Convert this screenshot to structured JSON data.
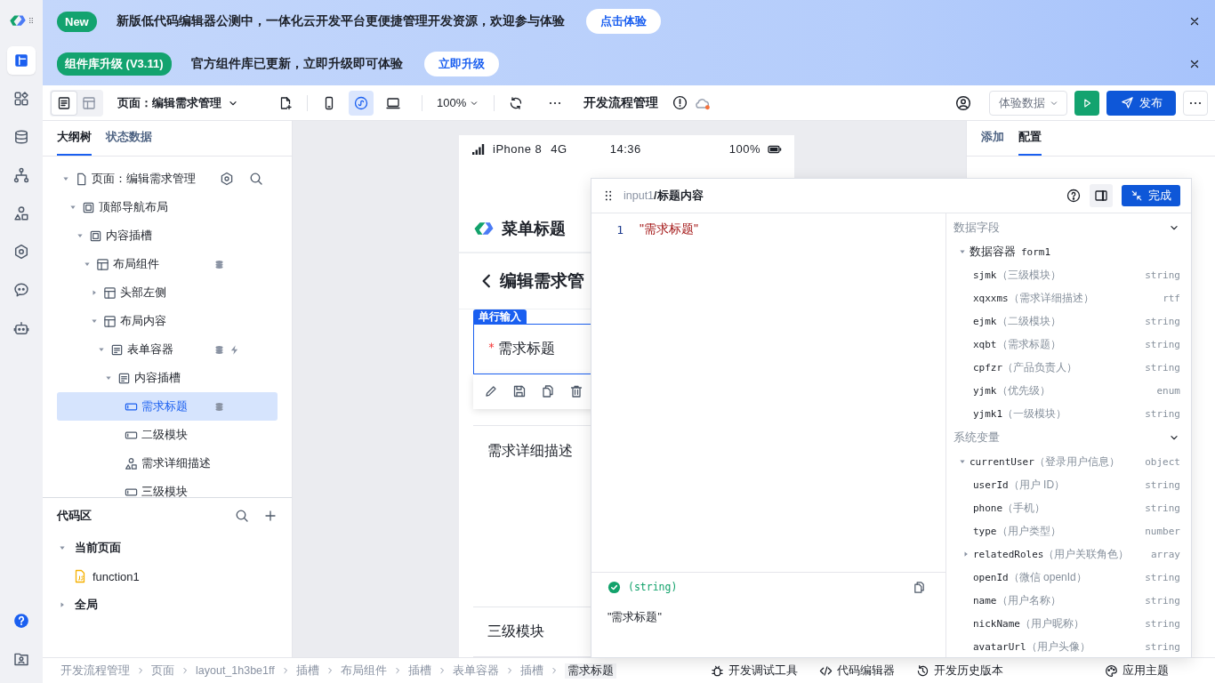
{
  "rail": {
    "top": [
      {
        "kind": "outline",
        "selected": true
      },
      {
        "kind": "components",
        "selected": false
      },
      {
        "kind": "database",
        "selected": false
      },
      {
        "kind": "flow",
        "selected": false
      },
      {
        "kind": "shapes",
        "selected": false
      },
      {
        "kind": "settings",
        "selected": false
      },
      {
        "kind": "chat",
        "selected": false
      },
      {
        "kind": "robot",
        "selected": false
      }
    ],
    "bottom": [
      {
        "kind": "help"
      },
      {
        "kind": "contact"
      }
    ]
  },
  "banners": [
    {
      "badge": "New",
      "text": "新版低代码编辑器公测中，一体化云开发平台更便捷管理开发资源，欢迎参与体验",
      "button": "点击体验"
    },
    {
      "badge": "组件库升级 (V3.11)",
      "text": "官方组件库已更新，立即升级即可体验",
      "button": "立即升级"
    }
  ],
  "toolbar": {
    "view_modes": [
      {
        "kind": "list",
        "selected": true
      },
      {
        "kind": "layout",
        "selected": false
      }
    ],
    "page_select": "页面：编辑需求管理",
    "devices": [
      {
        "kind": "phone",
        "selected": false
      },
      {
        "kind": "miniapp",
        "selected": true
      },
      {
        "kind": "desktop",
        "selected": false
      }
    ],
    "zoom": "100%",
    "title": "开发流程管理",
    "data_select": "体验数据",
    "publish": "发布"
  },
  "left_panel": {
    "tabs": [
      {
        "label": "大纲树",
        "selected": true
      },
      {
        "label": "状态数据",
        "selected": false
      }
    ],
    "outline": [
      {
        "label": "页面：编辑需求管理",
        "kind": "page",
        "expanded": true,
        "selected": false,
        "children": [
          {
            "label": "顶部导航布局",
            "kind": "frame",
            "expanded": true,
            "selected": false,
            "children": [
              {
                "label": "内容插槽",
                "kind": "frame",
                "expanded": true,
                "selected": false,
                "children": [
                  {
                    "label": "布局组件",
                    "kind": "layout",
                    "expanded": true,
                    "selected": false,
                    "data_bound": true,
                    "children": [
                      {
                        "label": "头部左侧",
                        "kind": "layout",
                        "expanded": false,
                        "selected": false
                      },
                      {
                        "label": "布局内容",
                        "kind": "layout",
                        "expanded": true,
                        "selected": false,
                        "children": [
                          {
                            "label": "表单容器",
                            "kind": "form",
                            "expanded": true,
                            "selected": false,
                            "data_bound": true,
                            "has_event": true,
                            "children": [
                              {
                                "label": "内容插槽",
                                "kind": "form",
                                "expanded": true,
                                "selected": false,
                                "children": [
                                  {
                                    "label": "需求标题",
                                    "kind": "input",
                                    "selected": true,
                                    "data_bound": true
                                  },
                                  {
                                    "label": "二级模块",
                                    "kind": "input",
                                    "selected": false
                                  },
                                  {
                                    "label": "需求详细描述",
                                    "kind": "shapes",
                                    "selected": false
                                  },
                                  {
                                    "label": "三级模块",
                                    "kind": "input",
                                    "selected": false
                                  }
                                ]
                              }
                            ]
                          }
                        ]
                      }
                    ]
                  }
                ]
              }
            ]
          }
        ]
      }
    ],
    "code_area": {
      "title": "代码区",
      "groups": [
        {
          "label": "当前页面",
          "expanded": true,
          "children": [
            {
              "label": "function1"
            }
          ]
        },
        {
          "label": "全局",
          "expanded": false
        }
      ]
    }
  },
  "phone": {
    "carrier": "iPhone 8",
    "network": "4G",
    "time": "14:36",
    "battery": "100%",
    "header_title": "菜单标题",
    "page_title": "编辑需求管",
    "fields": [
      {
        "kind": "input",
        "label": "需求标题",
        "required": true,
        "selected": true,
        "tag": "单行输入"
      },
      {
        "kind": "textarea",
        "label": "需求详细描述",
        "required": false,
        "selected": false
      },
      {
        "kind": "input",
        "label": "三级模块",
        "required": false,
        "selected": false
      }
    ]
  },
  "right_panel": {
    "tabs": [
      {
        "label": "添加",
        "selected": false
      },
      {
        "label": "配置",
        "selected": true
      }
    ]
  },
  "popup": {
    "path": "input1",
    "title": "/标题内容",
    "done": "完成",
    "code_lines": [
      {
        "number": "1",
        "code": "\"需求标题\""
      }
    ],
    "result_type": "(string)",
    "result_value": "\"需求标题\"",
    "sections": [
      {
        "title": "数据字段",
        "expanded": true,
        "items": [
          {
            "kind": "container",
            "label": "数据容器",
            "name": "form1",
            "expanded": true,
            "children": [
              {
                "kind": "variable",
                "name": "sjmk",
                "label": "（三级模块）",
                "type": "string"
              },
              {
                "kind": "variable",
                "name": "xqxxms",
                "label": "（需求详细描述）",
                "type": "rtf"
              },
              {
                "kind": "variable",
                "name": "ejmk",
                "label": "（二级模块）",
                "type": "string"
              },
              {
                "kind": "variable",
                "name": "xqbt",
                "label": "（需求标题）",
                "type": "string"
              },
              {
                "kind": "variable",
                "name": "cpfzr",
                "label": "（产品负责人）",
                "type": "string"
              },
              {
                "kind": "variable",
                "name": "yjmk",
                "label": "（优先级）",
                "type": "enum"
              },
              {
                "kind": "variable",
                "name": "yjmk1",
                "label": "（一级模块）",
                "type": "string"
              }
            ]
          }
        ]
      },
      {
        "title": "系统变量",
        "expanded": true,
        "items": [
          {
            "kind": "variable",
            "name": "currentUser",
            "label": "（登录用户信息）",
            "type": "object",
            "expanded": true,
            "children": [
              {
                "kind": "variable",
                "name": "userId",
                "label": "（用户 ID）",
                "type": "string"
              },
              {
                "kind": "variable",
                "name": "phone",
                "label": "（手机）",
                "type": "string"
              },
              {
                "kind": "variable",
                "name": "type",
                "label": "（用户类型）",
                "type": "number"
              },
              {
                "kind": "variable",
                "name": "relatedRoles",
                "label": "（用户关联角色）",
                "type": "array",
                "expanded": false
              },
              {
                "kind": "variable",
                "name": "openId",
                "label": "（微信 openId）",
                "type": "string"
              },
              {
                "kind": "variable",
                "name": "name",
                "label": "（用户名称）",
                "type": "string"
              },
              {
                "kind": "variable",
                "name": "nickName",
                "label": "（用户昵称）",
                "type": "string"
              },
              {
                "kind": "variable",
                "name": "avatarUrl",
                "label": "（用户头像）",
                "type": "string"
              }
            ]
          }
        ]
      }
    ]
  },
  "breadcrumbs": [
    "开发流程管理",
    "页面",
    "layout_1h3be1ff",
    "插槽",
    "布局组件",
    "插槽",
    "表单容器",
    "插槽",
    "需求标题"
  ],
  "bottom_tools": [
    {
      "kind": "debug",
      "label": "开发调试工具"
    },
    {
      "kind": "code",
      "label": "代码编辑器"
    },
    {
      "kind": "history",
      "label": "开发历史版本"
    },
    {
      "kind": "theme",
      "label": "应用主题"
    }
  ]
}
